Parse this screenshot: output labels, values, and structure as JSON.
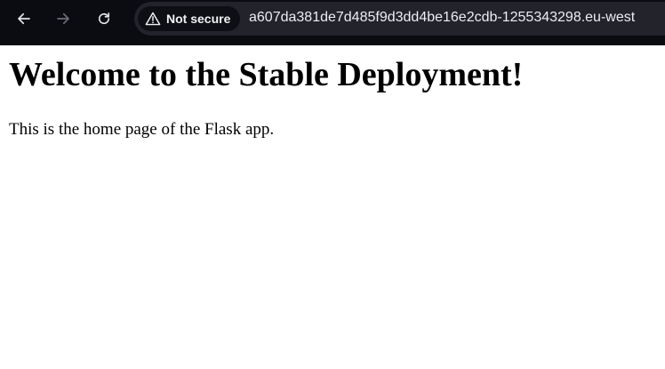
{
  "browser": {
    "security_label": "Not secure",
    "url": "a607da381de7d485f9d3dd4be16e2cdb-1255343298.eu-west",
    "icons": {
      "back": "back-arrow-icon",
      "forward": "forward-arrow-icon",
      "reload": "reload-icon",
      "security": "warning-triangle-icon"
    },
    "colors": {
      "toolbar": "#0b0c12",
      "omnibox": "#22232b",
      "chip": "#0e0f15"
    }
  },
  "page": {
    "heading": "Welcome to the Stable Deployment!",
    "paragraph": "This is the home page of the Flask app."
  }
}
